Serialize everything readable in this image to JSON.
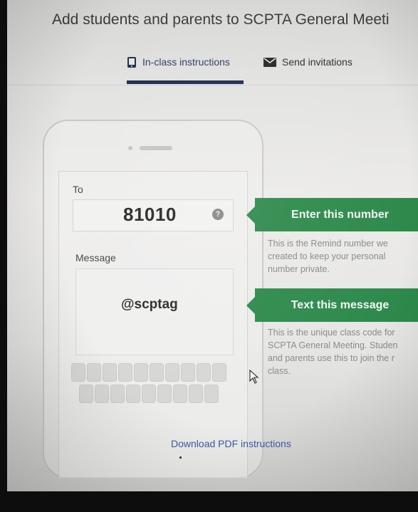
{
  "header": {
    "title": "Add students and parents to SCPTA General Meeti"
  },
  "tabs": [
    {
      "label": "In-class instructions",
      "icon": "phone-icon",
      "active": true
    },
    {
      "label": "Send invitations",
      "icon": "envelope-icon",
      "active": false
    }
  ],
  "phone": {
    "to_label": "To",
    "number": "81010",
    "help_glyph": "?",
    "message_label": "Message",
    "message": "@scptag"
  },
  "callouts": [
    {
      "heading": "Enter this number",
      "description": "This is the Remind number we\ncreated to keep your personal\nnumber private."
    },
    {
      "heading": "Text this message",
      "description": "This is the unique class code for\nSCPTA General Meeting. Studen\nand parents use this to join the r\nclass."
    }
  ],
  "footer": {
    "download_label": "Download PDF instructions"
  },
  "colors": {
    "accent_green": "#2e8a4c",
    "tab_active": "#1f2d4f",
    "link_blue": "#3e5aa2"
  }
}
